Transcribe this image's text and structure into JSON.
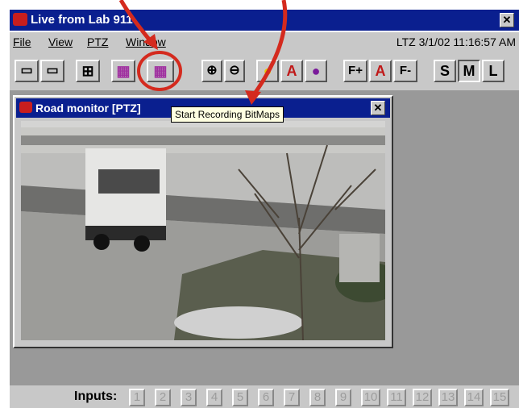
{
  "window": {
    "title": "Live from Lab 911",
    "close_label": "✕"
  },
  "menu": {
    "items": [
      "File",
      "View",
      "PTZ",
      "Window"
    ],
    "clock": "LTZ 3/1/02 11:16:57 AM"
  },
  "toolbar": {
    "buttons": [
      {
        "name": "view-single",
        "label": "▭"
      },
      {
        "name": "view-double",
        "label": "▭"
      },
      {
        "name": "view-quad",
        "label": "⊞"
      },
      {
        "name": "film-strip",
        "label": "▦"
      },
      {
        "name": "start-recording-bitmaps",
        "label": "▦"
      },
      {
        "name": "zoom-in",
        "label": "⊕"
      },
      {
        "name": "zoom-out",
        "label": "⊖"
      },
      {
        "name": "iris-yellow",
        "label": "●"
      },
      {
        "name": "auto-iris",
        "label": "A"
      },
      {
        "name": "iris-purple",
        "label": "●"
      },
      {
        "name": "focus-plus",
        "label": "F+"
      },
      {
        "name": "auto-focus",
        "label": "A"
      },
      {
        "name": "focus-minus",
        "label": "F-"
      },
      {
        "name": "size-small",
        "label": "S"
      },
      {
        "name": "size-medium",
        "label": "M"
      },
      {
        "name": "size-large",
        "label": "L"
      }
    ],
    "tooltip": "Start Recording BitMaps"
  },
  "child_window": {
    "title": "Road monitor [PTZ]",
    "close_label": "✕"
  },
  "inputs": {
    "label": "Inputs:",
    "values": [
      "1",
      "2",
      "3",
      "4",
      "5",
      "6",
      "7",
      "8",
      "9",
      "10",
      "11",
      "12",
      "13",
      "14",
      "15"
    ]
  },
  "colors": {
    "title_bar": "#0a1f8f",
    "annotation_red": "#d42a1e",
    "tooltip_bg": "#ffffe1",
    "face": "#c8c8c8"
  }
}
